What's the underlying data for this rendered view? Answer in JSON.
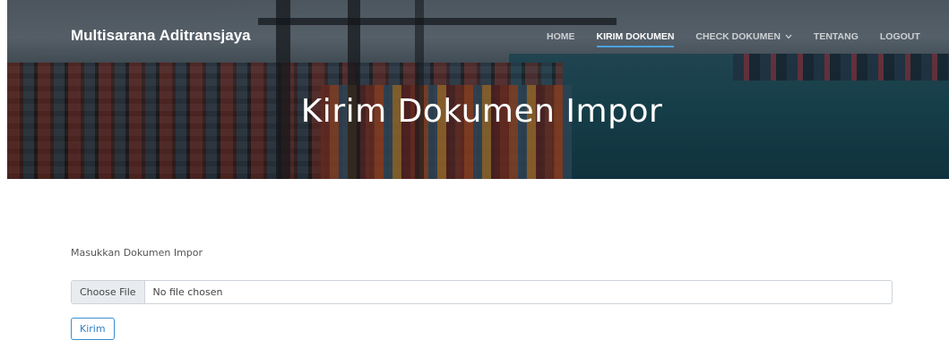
{
  "header": {
    "brand": "Multisarana Aditransjaya",
    "nav": [
      {
        "label": "HOME"
      },
      {
        "label": "KIRIM DOKUMEN"
      },
      {
        "label": "CHECK DOKUMEN"
      },
      {
        "label": "TENTANG"
      },
      {
        "label": "LOGOUT"
      }
    ],
    "dropdown_icon": "chevron-down-icon"
  },
  "hero": {
    "title": "Kirim Dokumen Impor"
  },
  "form": {
    "label": "Masukkan Dokumen Impor",
    "file_button": "Choose File",
    "file_status": "No file chosen",
    "submit_label": "Kirim"
  },
  "colors": {
    "accent": "#3a8fd1",
    "nav_underline": "#4aa3df"
  }
}
